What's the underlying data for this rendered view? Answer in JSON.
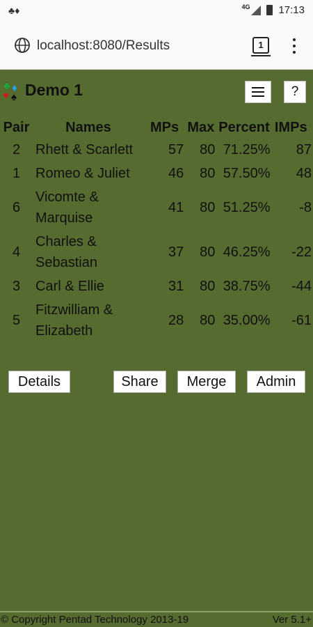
{
  "status_bar": {
    "network": "4G",
    "time": "17:13"
  },
  "browser": {
    "url": "localhost:8080/Results",
    "tab_count": "1"
  },
  "app": {
    "suits": {
      "club": "♣",
      "diamond": "♦",
      "heart": "♥",
      "spade": "♠"
    },
    "title": "Demo 1",
    "help_label": "?",
    "columns": {
      "pair": "Pair",
      "names": "Names",
      "mps": "MPs",
      "max": "Max",
      "percent": "Percent",
      "imps": "IMPs"
    },
    "rows": [
      {
        "pair": "2",
        "names": "Rhett & Scarlett",
        "mps": "57",
        "max": "80",
        "percent": "71.25%",
        "imps": "87"
      },
      {
        "pair": "1",
        "names": "Romeo & Juliet",
        "mps": "46",
        "max": "80",
        "percent": "57.50%",
        "imps": "48"
      },
      {
        "pair": "6",
        "names": "Vicomte & Marquise",
        "mps": "41",
        "max": "80",
        "percent": "51.25%",
        "imps": "-8"
      },
      {
        "pair": "4",
        "names": "Charles & Sebastian",
        "mps": "37",
        "max": "80",
        "percent": "46.25%",
        "imps": "-22"
      },
      {
        "pair": "3",
        "names": "Carl & Ellie",
        "mps": "31",
        "max": "80",
        "percent": "38.75%",
        "imps": "-44"
      },
      {
        "pair": "5",
        "names": "Fitzwilliam & Elizabeth",
        "mps": "28",
        "max": "80",
        "percent": "35.00%",
        "imps": "-61"
      }
    ],
    "buttons": {
      "details": "Details",
      "share": "Share",
      "merge": "Merge",
      "admin": "Admin"
    },
    "footer": {
      "copyright": "© Copyright Pentad Technology 2013-19",
      "version": "Ver 5.1+"
    },
    "colors": {
      "background": "#556b2f",
      "club": "#1ea83c",
      "diamond": "#1fa3e8",
      "heart": "#d01b1b",
      "spade": "#111111"
    }
  }
}
